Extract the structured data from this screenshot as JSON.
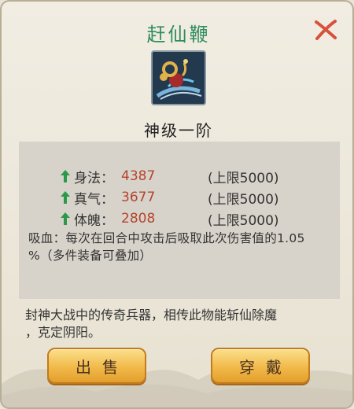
{
  "item": {
    "name": "赶仙鞭",
    "rank": "神级一阶",
    "icon": "whip-icon"
  },
  "stats": [
    {
      "name": "身法：",
      "value": "4387",
      "cap": "(上限5000)"
    },
    {
      "name": "真气：",
      "value": "3677",
      "cap": "(上限5000)"
    },
    {
      "name": "体魄：",
      "value": "2808",
      "cap": "(上限5000)"
    }
  ],
  "effect_line1": "吸血：每次在回合中攻击后吸取此次伤害值的1.05",
  "effect_line2": "%（多件装备可叠加）",
  "description_line1": "封神大战中的传奇兵器，相传此物能斩仙除魔",
  "description_line2": "，克定阴阳。",
  "buttons": {
    "sell": "出售",
    "equip": "穿戴"
  },
  "colors": {
    "title": "#2f8c5e",
    "stat_value": "#b4442b",
    "arrow": "#2a9a4a",
    "close": "#d9503c",
    "button": "#f1b94a"
  }
}
